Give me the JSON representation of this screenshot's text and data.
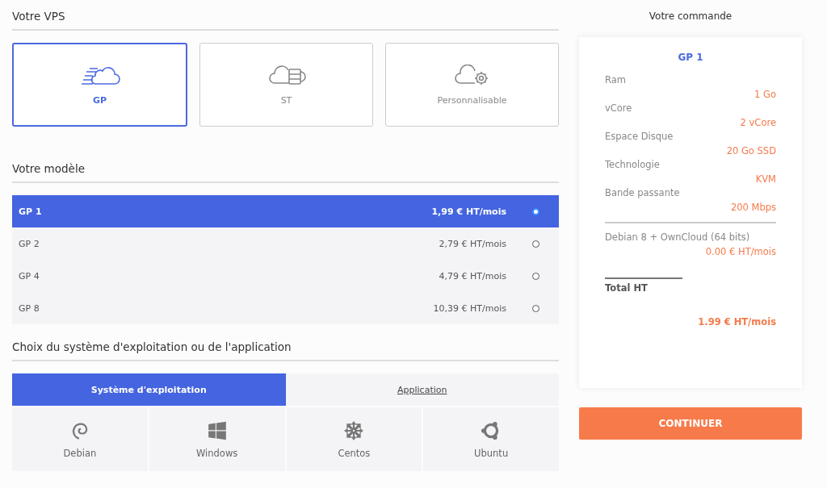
{
  "vps": {
    "title": "Votre VPS",
    "types": [
      {
        "label": "GP",
        "kind": "speed",
        "selected": true
      },
      {
        "label": "ST",
        "kind": "server",
        "selected": false
      },
      {
        "label": "Personnalisable",
        "kind": "gear",
        "selected": false
      }
    ]
  },
  "models": {
    "title": "Votre modèle",
    "rows": [
      {
        "name": "GP 1",
        "price": "1,99 € HT/mois",
        "selected": true
      },
      {
        "name": "GP 2",
        "price": "2,79 € HT/mois",
        "selected": false
      },
      {
        "name": "GP 4",
        "price": "4,79 € HT/mois",
        "selected": false
      },
      {
        "name": "GP 8",
        "price": "10,39 € HT/mois",
        "selected": false
      }
    ]
  },
  "os_section": {
    "title": "Choix du système d'exploitation ou de l'application",
    "tabs": [
      {
        "label": "Système d'exploitation",
        "selected": true
      },
      {
        "label": "Application",
        "selected": false
      }
    ],
    "systems": [
      {
        "label": "Debian",
        "kind": "debian"
      },
      {
        "label": "Windows",
        "kind": "windows"
      },
      {
        "label": "Centos",
        "kind": "centos"
      },
      {
        "label": "Ubuntu",
        "kind": "ubuntu"
      }
    ]
  },
  "order": {
    "title": "Votre commande",
    "plan": "GP 1",
    "specs": [
      {
        "label": "Ram",
        "value": "1 Go"
      },
      {
        "label": "vCore",
        "value": "2 vCore"
      },
      {
        "label": "Espace Disque",
        "value": "20 Go SSD"
      },
      {
        "label": "Technologie",
        "value": "KVM"
      },
      {
        "label": "Bande passante",
        "value": "200 Mbps"
      }
    ],
    "option": {
      "label": "Debian 8 + OwnCloud (64 bits)",
      "price": "0.00 € HT/mois"
    },
    "total_label": "Total HT",
    "total": "1.99 € HT/mois",
    "button": "CONTINUER"
  }
}
